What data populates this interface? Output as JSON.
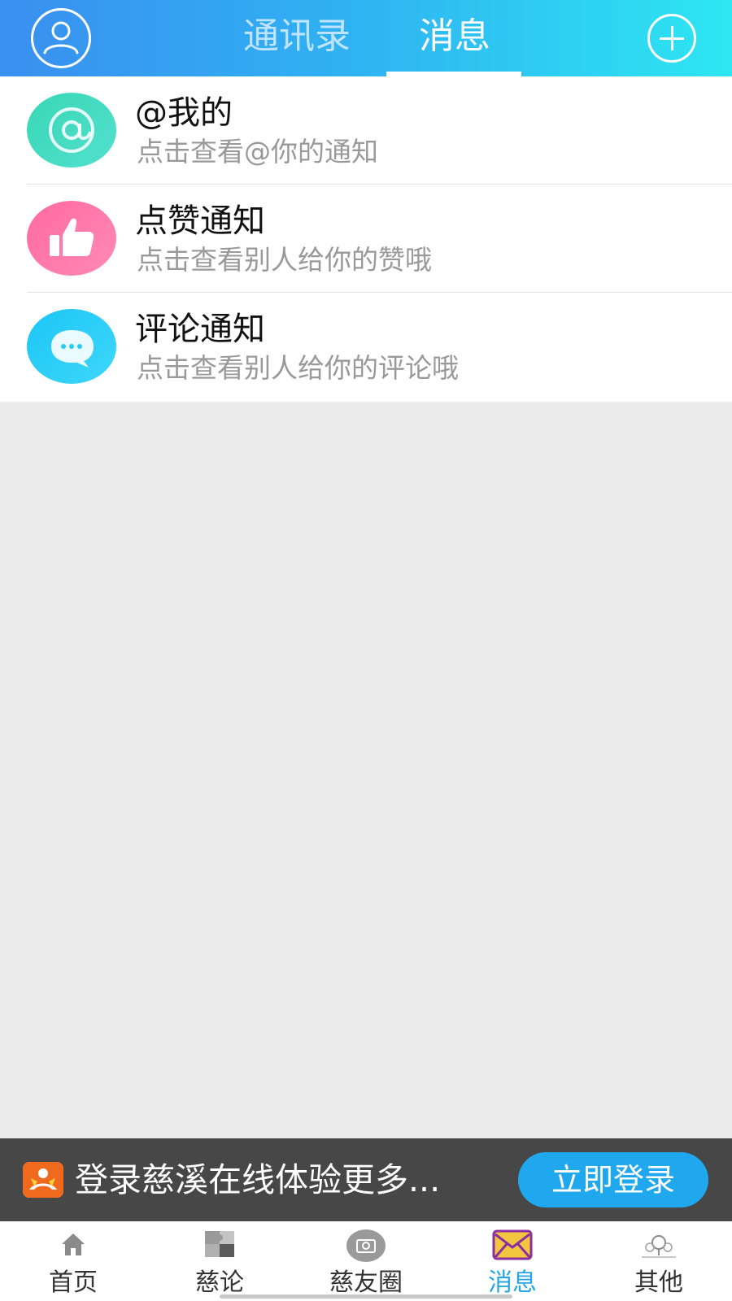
{
  "header": {
    "tabs": [
      {
        "label": "通讯录",
        "active": false
      },
      {
        "label": "消息",
        "active": true
      }
    ],
    "avatar_icon": "user-icon",
    "add_icon": "plus-icon"
  },
  "messages": [
    {
      "icon": "at-icon",
      "title": "@我的",
      "subtitle": "点击查看@你的通知",
      "color": "#3cd8b8"
    },
    {
      "icon": "thumbs-up-icon",
      "title": "点赞通知",
      "subtitle": "点击查看别人给你的赞哦",
      "color": "#ff78a8"
    },
    {
      "icon": "chat-bubble-icon",
      "title": "评论通知",
      "subtitle": "点击查看别人给你的评论哦",
      "color": "#24ccf6"
    }
  ],
  "banner": {
    "text": "登录慈溪在线体验更多...",
    "button_label": "立即登录",
    "logo_icon": "app-logo-icon"
  },
  "bottom_nav": [
    {
      "label": "首页",
      "icon": "home-icon",
      "active": false
    },
    {
      "label": "慈论",
      "icon": "puzzle-icon",
      "active": false
    },
    {
      "label": "慈友圈",
      "icon": "camera-icon",
      "active": false
    },
    {
      "label": "消息",
      "icon": "envelope-icon",
      "active": true
    },
    {
      "label": "其他",
      "icon": "map-pin-icon",
      "active": false
    }
  ],
  "colors": {
    "header_gradient_start": "#3a8ff0",
    "header_gradient_end": "#2ee6f2",
    "active_tab": "#24a6e8",
    "banner_bg": "#474747",
    "login_button": "#1fa8ee"
  }
}
